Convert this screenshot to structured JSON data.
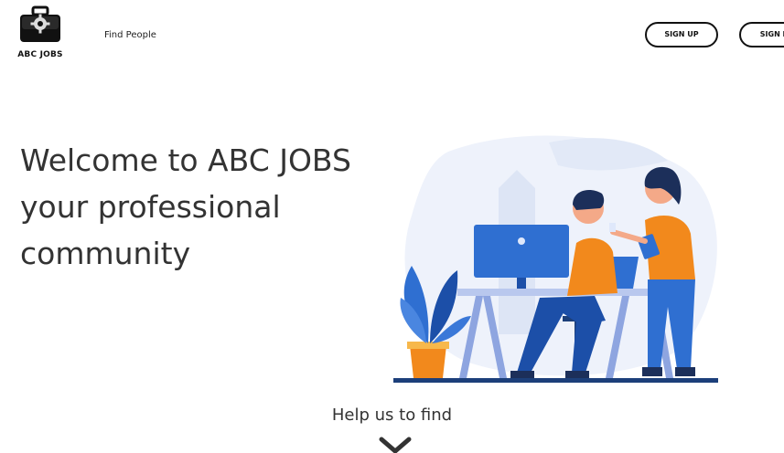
{
  "header": {
    "logo_text": "ABC JOBS",
    "nav": {
      "find_people": "Find People"
    },
    "buttons": {
      "sign_up": "SIGN UP",
      "sign_in": "SIGN IN"
    }
  },
  "hero": {
    "line1": "Welcome to ABC JOBS",
    "line2": "your professional",
    "line3": "community"
  },
  "footer_prompt": {
    "text": "Help us to find"
  },
  "icons": {
    "logo": "briefcase-gear-icon",
    "scroll": "chevron-down-icon"
  },
  "colors": {
    "accent_blue": "#2f6fd1",
    "accent_orange": "#f2891c",
    "text_dark": "#333333"
  }
}
